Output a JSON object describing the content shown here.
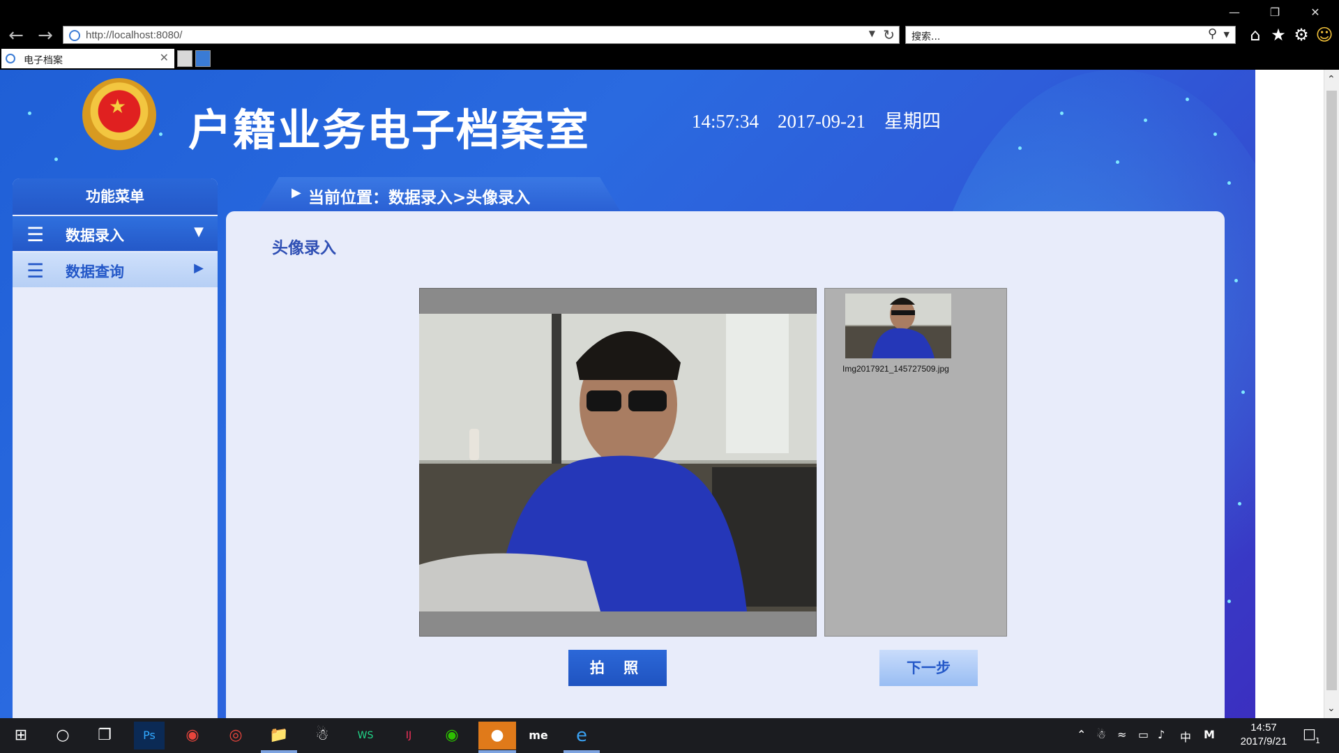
{
  "browser": {
    "url": "http://localhost:8080/",
    "search_placeholder": "搜索...",
    "tab_title": "电子档案"
  },
  "header": {
    "site_title": "户籍业务电子档案室",
    "time": "14:57:34",
    "date": "2017-09-21",
    "weekday": "星期四"
  },
  "sidebar": {
    "title": "功能菜单",
    "items": [
      {
        "label": "数据录入",
        "state": "expanded"
      },
      {
        "label": "数据查询",
        "state": "collapsed"
      }
    ]
  },
  "breadcrumb": "当前位置：数据录入>头像录入",
  "main": {
    "title": "头像录入",
    "thumbnail_filename": "Img2017921_145727509.jpg",
    "photo_button": "拍 照",
    "next_button": "下一步"
  },
  "taskbar": {
    "time": "14:57",
    "date": "2017/9/21",
    "ime": "中",
    "notification_count": "1"
  },
  "colors": {
    "brand_blue": "#2458c8",
    "panel_bg": "#e8ecfa"
  }
}
